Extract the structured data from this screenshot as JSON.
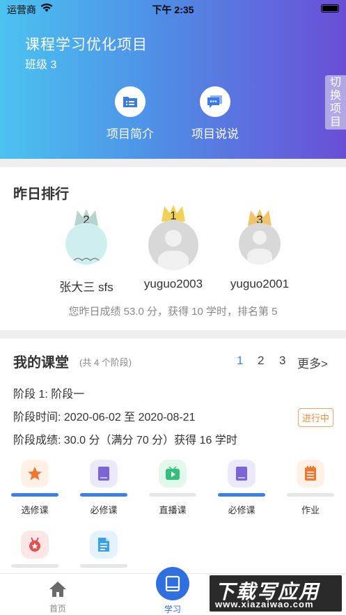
{
  "status_bar": {
    "carrier": "运营商",
    "time": "下午 2:35"
  },
  "project": {
    "title": "课程学习优化项目",
    "class_name": "班级 3",
    "intro_label": "项目简介",
    "talk_label": "项目说说",
    "switch_label": "切换项目"
  },
  "ranking": {
    "title": "昨日排行",
    "entries": [
      {
        "rank": "2",
        "name": "张大三 sfs"
      },
      {
        "rank": "1",
        "name": "yuguo2003"
      },
      {
        "rank": "3",
        "name": "yuguo2001"
      }
    ],
    "summary": "您昨日成绩 53.0 分，获得 10 学时，排名第 5"
  },
  "classroom": {
    "title": "我的课堂",
    "stage_count": "(共 4 个阶段)",
    "pages": [
      "1",
      "2",
      "3"
    ],
    "more": "更多>",
    "stage": "阶段 1:  阶段一",
    "stage_time": "阶段时间:  2020-06-02 至 2020-08-21",
    "stage_score": "阶段成绩:  30.0 分（满分 70 分）获得 16 学时",
    "status": "进行中",
    "modules": [
      {
        "label": "选修课",
        "icon": "star-icon",
        "progress": 1.0
      },
      {
        "label": "必修课",
        "icon": "book-icon",
        "progress": 1.0
      },
      {
        "label": "直播课",
        "icon": "play-icon",
        "progress": 0.0
      },
      {
        "label": "必修课",
        "icon": "book-icon",
        "progress": 1.0
      },
      {
        "label": "作业",
        "icon": "notepad-icon",
        "progress": 0.0
      },
      {
        "label": "",
        "icon": "medal-icon",
        "progress": 0.0
      },
      {
        "label": "",
        "icon": "document-icon",
        "progress": 0.0
      }
    ]
  },
  "tabbar": {
    "home": "首页",
    "study": "学习"
  },
  "watermark": {
    "line1": "下载写应用",
    "line2": "www.xiazaiwao.com"
  },
  "colors": {
    "accent": "#3b82f6",
    "status": "#f08a44",
    "crown_gold": "#f3d058",
    "crown_silver": "#b7d3d0"
  }
}
